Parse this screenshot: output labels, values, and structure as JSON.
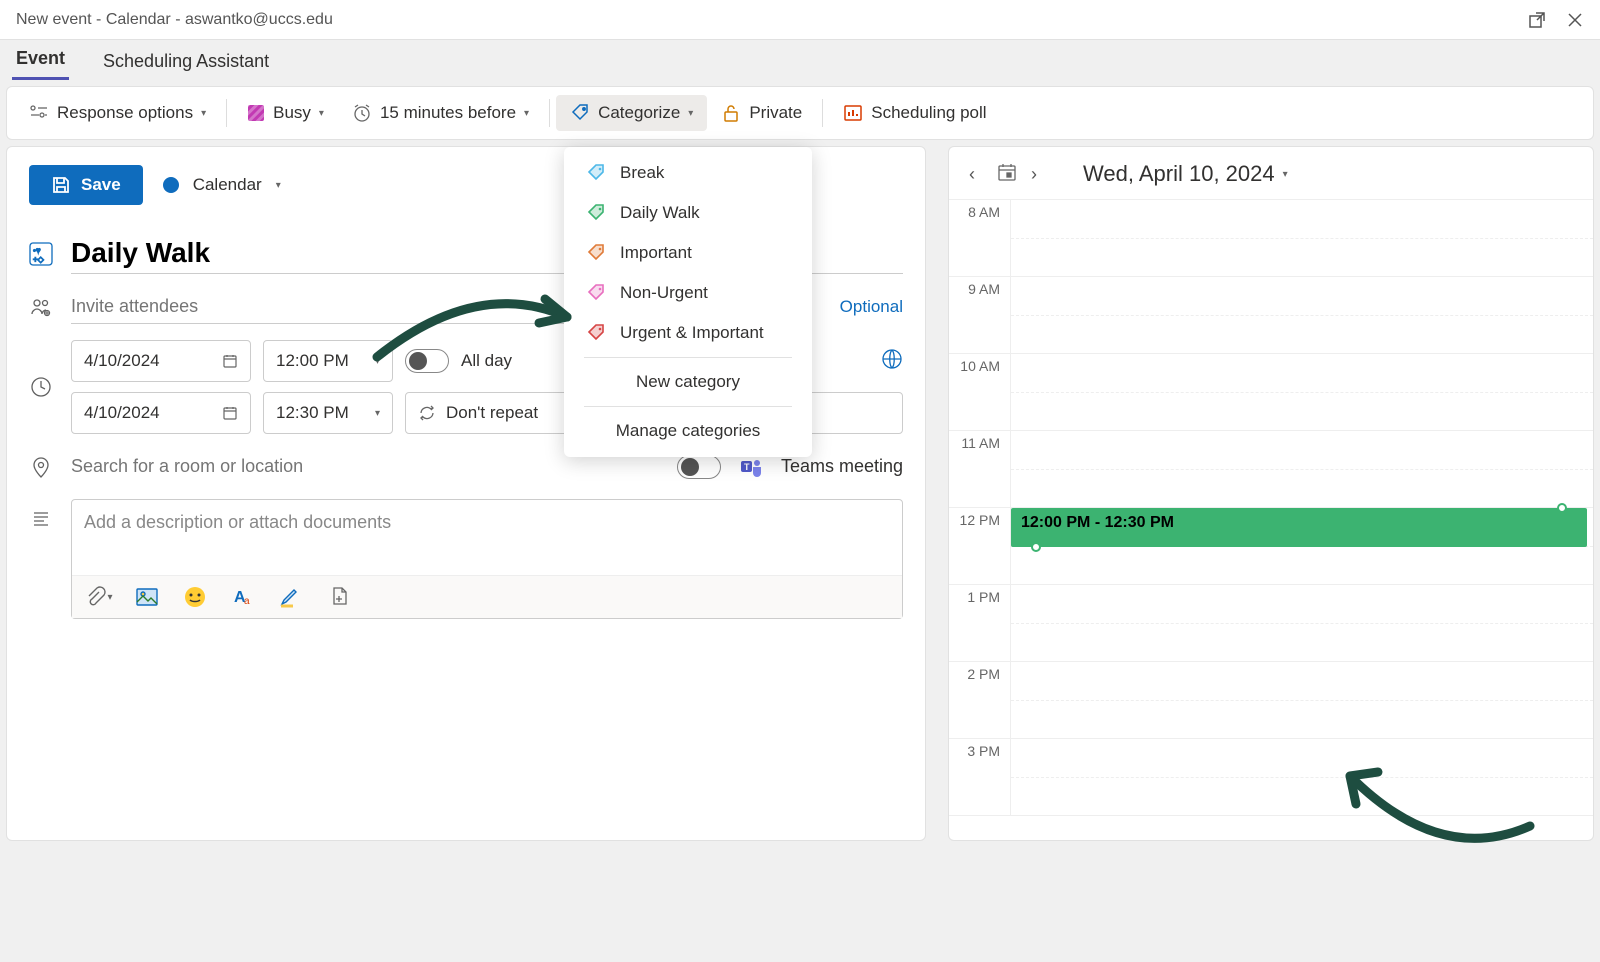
{
  "window": {
    "title": "New event - Calendar - aswantko@uccs.edu"
  },
  "tabs": {
    "event": "Event",
    "scheduling": "Scheduling Assistant"
  },
  "ribbon": {
    "response": "Response options",
    "busy": "Busy",
    "reminder": "15 minutes before",
    "categorize": "Categorize",
    "private": "Private",
    "poll": "Scheduling poll"
  },
  "save": {
    "label": "Save"
  },
  "calendar_chip": {
    "label": "Calendar"
  },
  "form": {
    "title": "Daily Walk",
    "attendees_placeholder": "Invite attendees",
    "optional": "Optional",
    "start_date": "4/10/2024",
    "start_time": "12:00 PM",
    "end_date": "4/10/2024",
    "end_time": "12:30 PM",
    "all_day": "All day",
    "repeat": "Don't repeat",
    "location_placeholder": "Search for a room or location",
    "teams": "Teams meeting",
    "description_placeholder": "Add a description or attach documents"
  },
  "dropdown": {
    "items": [
      {
        "label": "Break",
        "color": "#4db8e8"
      },
      {
        "label": "Daily Walk",
        "color": "#3cb371"
      },
      {
        "label": "Important",
        "color": "#e07b39"
      },
      {
        "label": "Non-Urgent",
        "color": "#e86fbf"
      },
      {
        "label": "Urgent & Important",
        "color": "#d64545"
      }
    ],
    "new": "New category",
    "manage": "Manage categories"
  },
  "calendar": {
    "date_label": "Wed, April 10, 2024",
    "hours": [
      "8 AM",
      "9 AM",
      "10 AM",
      "11 AM",
      "12 PM",
      "1 PM",
      "2 PM",
      "3 PM"
    ],
    "event": {
      "label": "12:00 PM - 12:30 PM",
      "start_hour_index": 4,
      "duration_half_hours": 1
    }
  }
}
